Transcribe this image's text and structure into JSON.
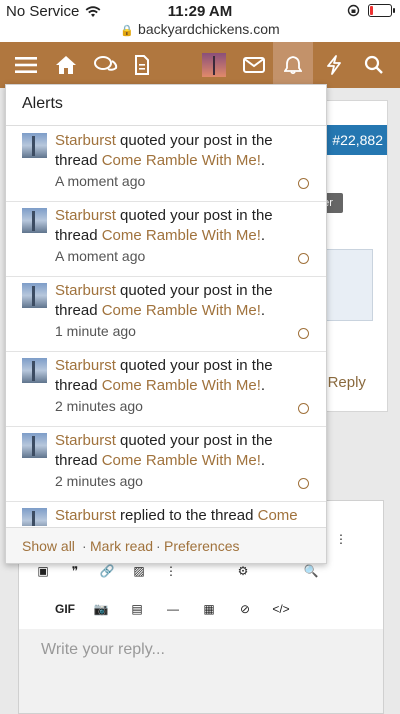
{
  "status": {
    "carrier": "No Service",
    "time": "11:29 AM",
    "url": "backyardchickens.com"
  },
  "nav": {
    "icons": [
      "menu-icon",
      "home-icon",
      "chat-icon",
      "document-icon",
      "avatar",
      "mail-icon",
      "bell-icon",
      "bolt-icon",
      "search-icon"
    ]
  },
  "background": {
    "post_number": "#22,882",
    "badge": "ber",
    "reply": "Reply",
    "editor_placeholder": "Write your reply...",
    "gif": "GIF"
  },
  "alerts": {
    "title": "Alerts",
    "items": [
      {
        "user": "Starburst",
        "action": " quoted your post in the thread ",
        "thread": "Come Ramble With Me!",
        "end": ".",
        "time": "A moment ago"
      },
      {
        "user": "Starburst",
        "action": " quoted your post in the thread ",
        "thread": "Come Ramble With Me!",
        "end": ".",
        "time": "A moment ago"
      },
      {
        "user": "Starburst",
        "action": " quoted your post in the thread ",
        "thread": "Come Ramble With Me!",
        "end": ".",
        "time": "1 minute ago"
      },
      {
        "user": "Starburst",
        "action": " quoted your post in the thread ",
        "thread": "Come Ramble With Me!",
        "end": ".",
        "time": "2 minutes ago"
      },
      {
        "user": "Starburst",
        "action": " quoted your post in the thread ",
        "thread": "Come Ramble With Me!",
        "end": ".",
        "time": "2 minutes ago"
      },
      {
        "user": "Starburst",
        "action": " replied to the thread ",
        "thread": "Come",
        "end": "",
        "time": ""
      }
    ],
    "footer": {
      "show_all": "Show all",
      "mark_read": "Mark read",
      "preferences": "Preferences",
      "sep": "·"
    }
  }
}
